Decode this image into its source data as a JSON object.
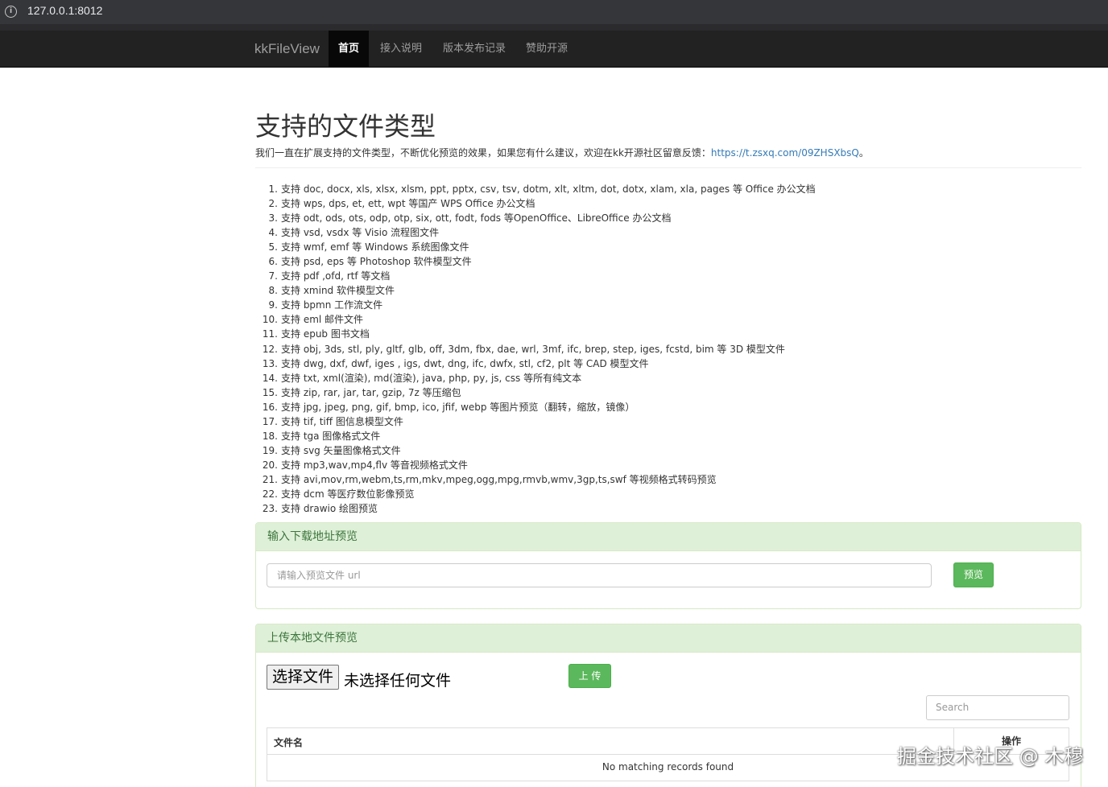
{
  "browser": {
    "url": "127.0.0.1:8012"
  },
  "nav": {
    "brand": "kkFileView",
    "items": [
      {
        "label": "首页",
        "active": true
      },
      {
        "label": "接入说明",
        "active": false
      },
      {
        "label": "版本发布记录",
        "active": false
      },
      {
        "label": "赞助开源",
        "active": false
      }
    ]
  },
  "header": {
    "title": "支持的文件类型",
    "intro_text": "我们一直在扩展支持的文件类型，不断优化预览的效果，如果您有什么建议，欢迎在kk开源社区留意反馈：",
    "intro_link": "https://t.zsxq.com/09ZHSXbsQ",
    "intro_end": "。"
  },
  "formats": [
    "支持 doc, docx, xls, xlsx, xlsm, ppt, pptx, csv, tsv, dotm, xlt, xltm, dot, dotx, xlam, xla, pages 等 Office 办公文档",
    "支持 wps, dps, et, ett, wpt 等国产 WPS Office 办公文档",
    "支持 odt, ods, ots, odp, otp, six, ott, fodt, fods 等OpenOffice、LibreOffice 办公文档",
    "支持 vsd, vsdx 等 Visio 流程图文件",
    "支持 wmf, emf 等 Windows 系统图像文件",
    "支持 psd, eps 等 Photoshop 软件模型文件",
    "支持 pdf ,ofd, rtf 等文档",
    "支持 xmind 软件模型文件",
    "支持 bpmn 工作流文件",
    "支持 eml 邮件文件",
    "支持 epub 图书文档",
    "支持 obj, 3ds, stl, ply, gltf, glb, off, 3dm, fbx, dae, wrl, 3mf, ifc, brep, step, iges, fcstd, bim 等 3D 模型文件",
    "支持 dwg, dxf, dwf, iges , igs, dwt, dng, ifc, dwfx, stl, cf2, plt 等 CAD 模型文件",
    "支持 txt, xml(渲染), md(渲染), java, php, py, js, css 等所有纯文本",
    "支持 zip, rar, jar, tar, gzip, 7z 等压缩包",
    "支持 jpg, jpeg, png, gif, bmp, ico, jfif, webp 等图片预览（翻转，缩放，镜像）",
    "支持 tif, tiff 图信息模型文件",
    "支持 tga 图像格式文件",
    "支持 svg 矢量图像格式文件",
    "支持 mp3,wav,mp4,flv 等音视频格式文件",
    "支持 avi,mov,rm,webm,ts,rm,mkv,mpeg,ogg,mpg,rmvb,wmv,3gp,ts,swf 等视频格式转码预览",
    "支持 dcm 等医疗数位影像预览",
    "支持 drawio 绘图预览"
  ],
  "url_panel": {
    "title": "输入下载地址预览",
    "placeholder": "请输入预览文件 url",
    "button": "预览"
  },
  "upload_panel": {
    "title": "上传本地文件预览",
    "choose_label": "选择文件",
    "no_file_text": "未选择任何文件",
    "upload_button": "上 传",
    "search_placeholder": "Search",
    "table_headers": [
      "文件名",
      "操作"
    ],
    "empty_text": "No matching records found"
  },
  "watermark": "掘金技术社区 @ 木穆"
}
